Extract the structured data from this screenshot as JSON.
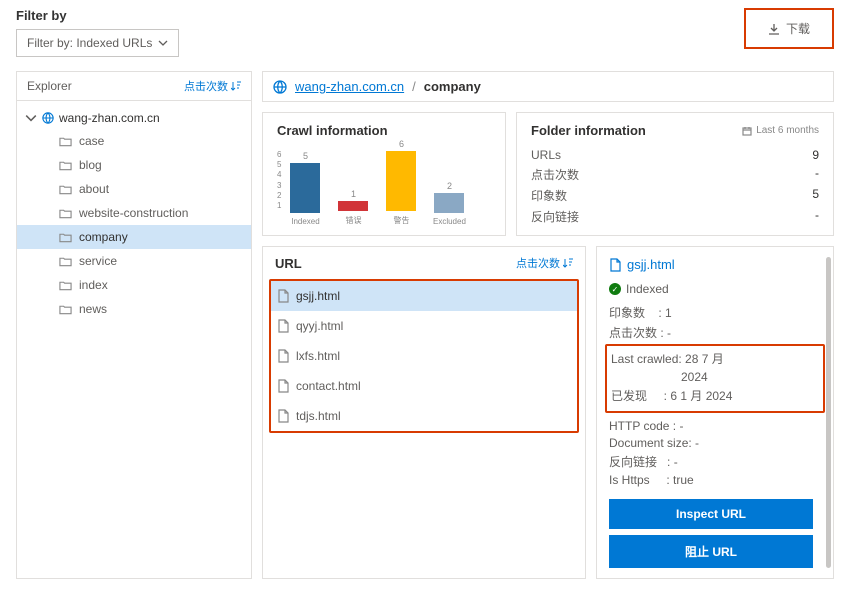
{
  "filter": {
    "label": "Filter by",
    "selected": "Filter by: Indexed URLs"
  },
  "download": {
    "label": "下载"
  },
  "explorer": {
    "title": "Explorer",
    "sort_label": "点击次数",
    "root": "wang-zhan.com.cn",
    "items": [
      {
        "label": "case"
      },
      {
        "label": "blog"
      },
      {
        "label": "about"
      },
      {
        "label": "website-construction"
      },
      {
        "label": "company",
        "selected": true
      },
      {
        "label": "service"
      },
      {
        "label": "index"
      },
      {
        "label": "news"
      }
    ]
  },
  "breadcrumb": {
    "domain": "wang-zhan.com.cn",
    "sep": "/",
    "current": "company"
  },
  "crawl": {
    "title": "Crawl information",
    "yticks": [
      "6",
      "5",
      "4",
      "3",
      "2",
      "1"
    ]
  },
  "folder": {
    "title": "Folder information",
    "period": "Last 6 months",
    "urls_k": "URLs",
    "urls_v": "9",
    "clicks_k": "点击次数",
    "clicks_v": "-",
    "imp_k": "印象数",
    "imp_v": "5",
    "bl_k": "反向链接",
    "bl_v": "-"
  },
  "url_table": {
    "title": "URL",
    "sort_label": "点击次数",
    "items": [
      {
        "name": "gsjj.html",
        "selected": true
      },
      {
        "name": "qyyj.html"
      },
      {
        "name": "lxfs.html"
      },
      {
        "name": "contact.html"
      },
      {
        "name": "tdjs.html"
      }
    ]
  },
  "detail": {
    "file": "gsjj.html",
    "status": "Indexed",
    "imp_k": "印象数",
    "imp_v": "1",
    "clicks_k": "点击次数",
    "clicks_v": "-",
    "crawl_k": "Last crawled:",
    "crawl_v1": "28 7 月",
    "crawl_v2": "2024",
    "disc_k": "已发现",
    "disc_v": "6 1 月 2024",
    "http_k": "HTTP code",
    "http_v": "-",
    "doc_k": "Document size:",
    "doc_v": "-",
    "bl_k": "反向链接",
    "bl_v": "-",
    "https_k": "Is Https",
    "https_v": "true",
    "inspect": "Inspect URL",
    "block": "阻止 URL"
  },
  "chart_data": {
    "type": "bar",
    "title": "Crawl information",
    "categories": [
      "Indexed",
      "错误",
      "警告",
      "Excluded"
    ],
    "values": [
      5,
      1,
      6,
      2
    ],
    "colors": [
      "#2b6a9b",
      "#d13438",
      "#ffb900",
      "#8aa8c4"
    ],
    "ylim": [
      0,
      6
    ],
    "xlabel": "",
    "ylabel": ""
  }
}
